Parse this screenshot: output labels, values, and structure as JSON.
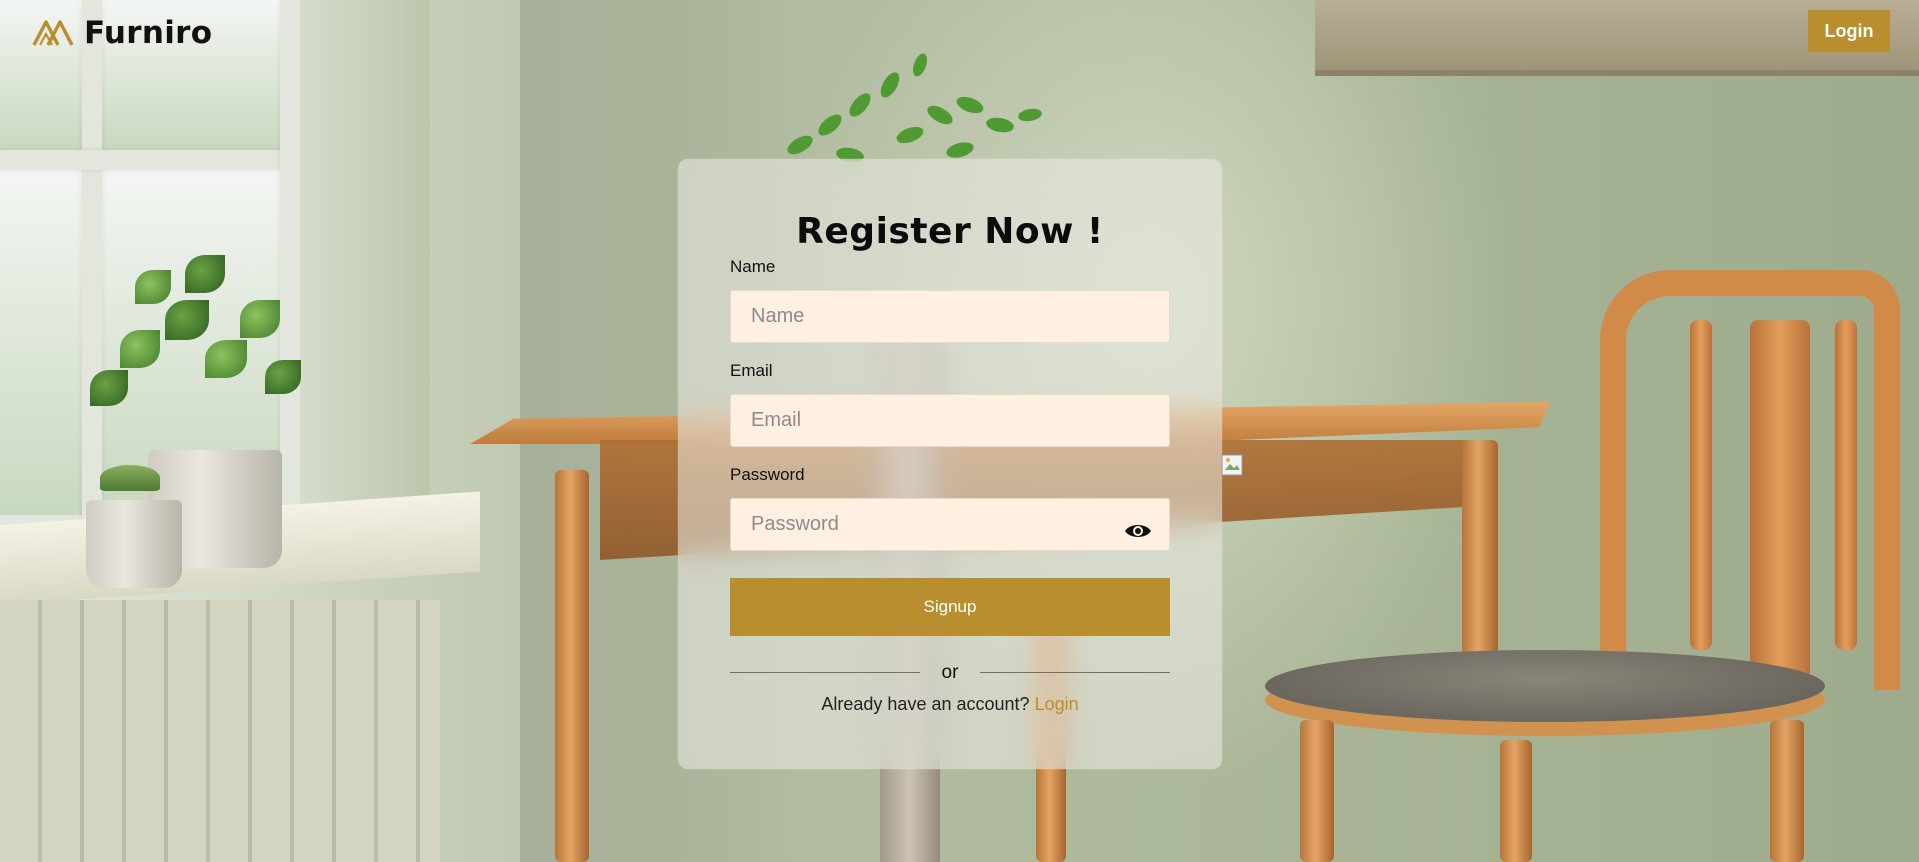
{
  "header": {
    "brand": "Furniro",
    "login_label": "Login"
  },
  "form": {
    "title": "Register Now !",
    "name_label": "Name",
    "name_placeholder": "Name",
    "email_label": "Email",
    "email_placeholder": "Email",
    "password_label": "Password",
    "password_placeholder": "Password",
    "signup_label": "Signup",
    "divider_text": "or",
    "have_account_text": "Already have an account?",
    "login_link_label": "Login"
  },
  "icons": {
    "logo": "furniro-logo-icon",
    "password_toggle": "eye-icon",
    "broken_image": "broken-image-icon"
  },
  "colors": {
    "accent": "#b88e2f",
    "input_bg": "#fff0e2",
    "text": "#111111"
  }
}
